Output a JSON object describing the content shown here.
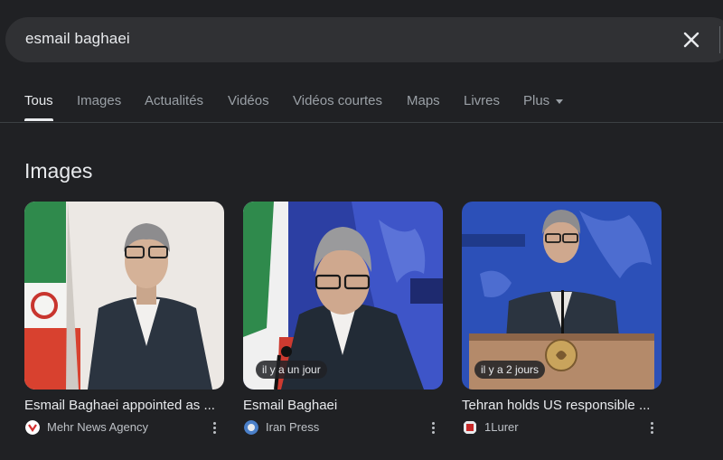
{
  "search": {
    "query": "esmail baghaei"
  },
  "tabs": [
    {
      "label": "Tous",
      "active": true
    },
    {
      "label": "Images"
    },
    {
      "label": "Actualités"
    },
    {
      "label": "Vidéos"
    },
    {
      "label": "Vidéos courtes"
    },
    {
      "label": "Maps"
    },
    {
      "label": "Livres"
    },
    {
      "label": "Plus"
    }
  ],
  "images_section": {
    "title": "Images",
    "cards": [
      {
        "title": "Esmail Baghaei appointed as ...",
        "source": "Mehr News Agency",
        "time": ""
      },
      {
        "title": "Esmail Baghaei",
        "source": "Iran Press",
        "time": "il y a un jour"
      },
      {
        "title": "Tehran holds US responsible ...",
        "source": "1Lurer",
        "time": "il y a 2 jours"
      }
    ]
  },
  "colors": {
    "background": "#202124",
    "searchbox": "#303134",
    "text": "#e8eaed",
    "muted": "#9aa0a6"
  }
}
